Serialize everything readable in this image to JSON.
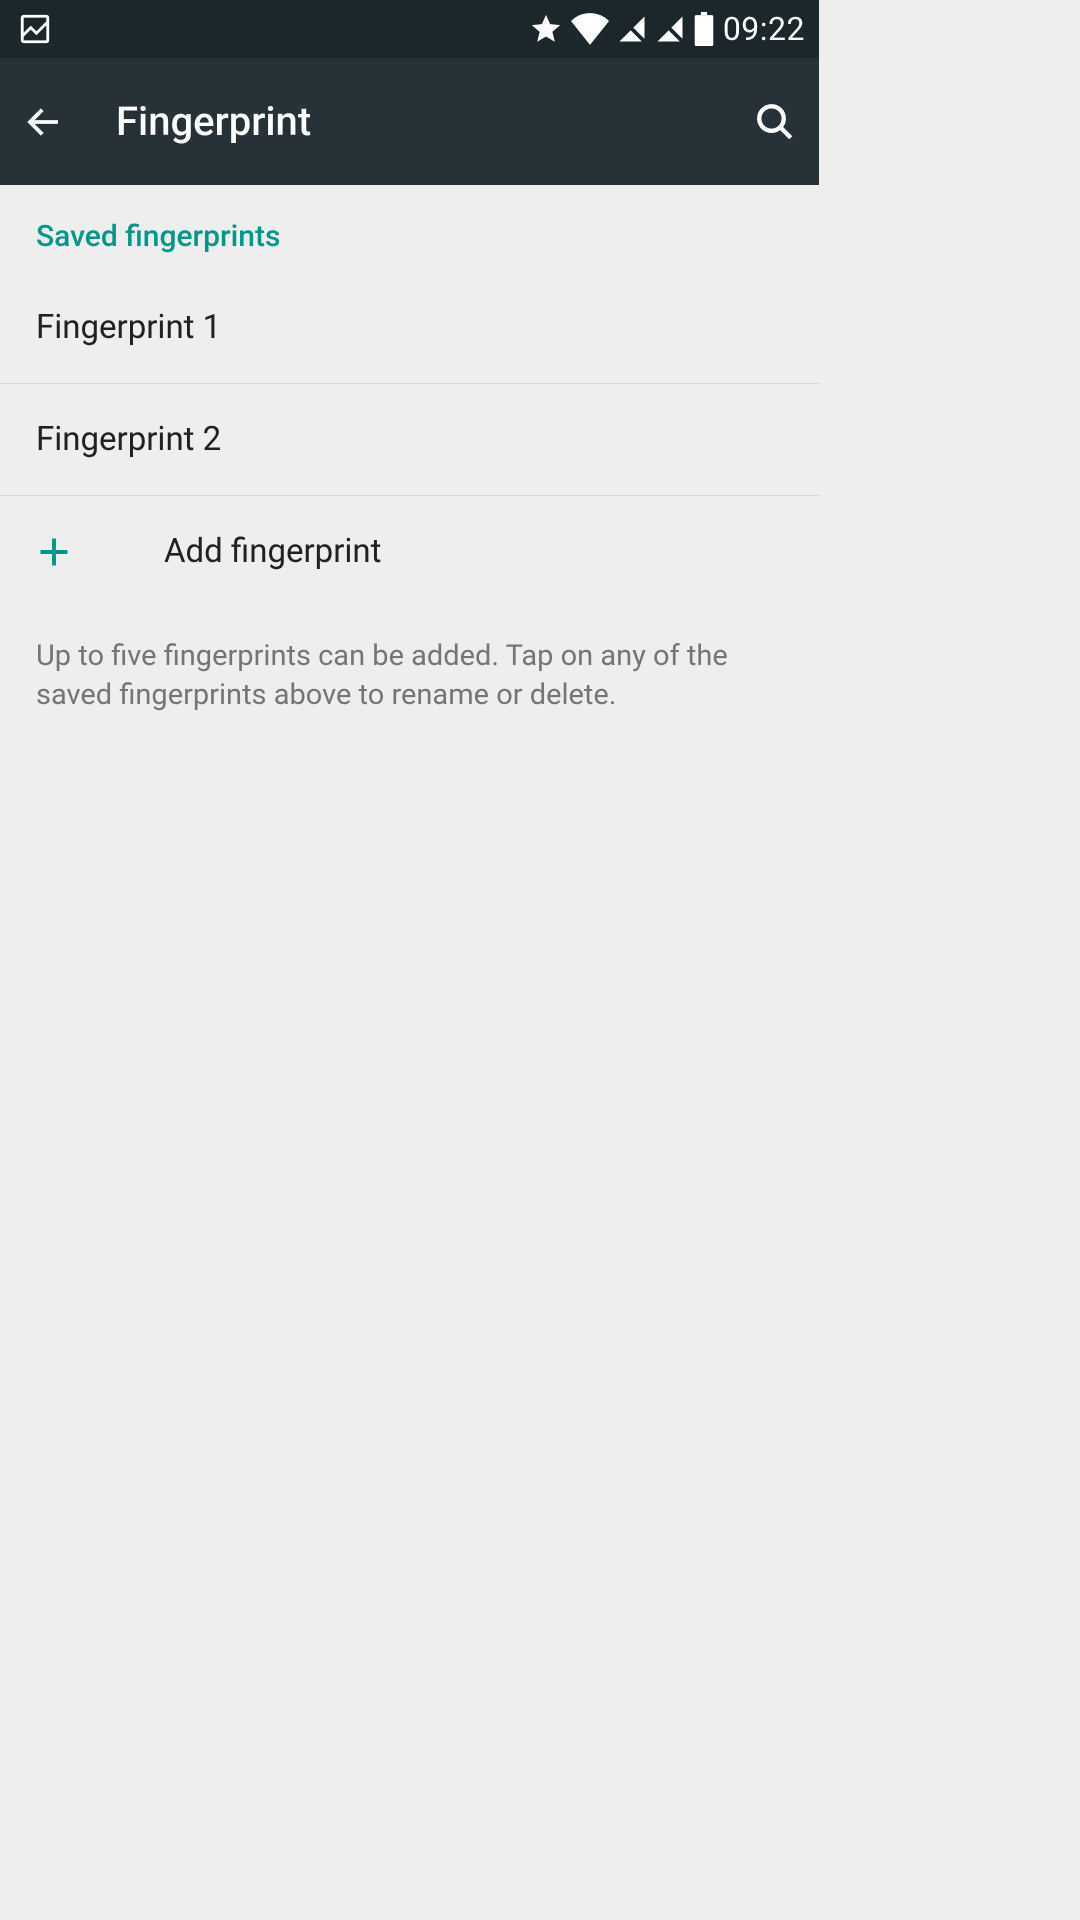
{
  "status": {
    "time": "09:22"
  },
  "appbar": {
    "title": "Fingerprint"
  },
  "section": {
    "header": "Saved fingerprints",
    "items": [
      "Fingerprint 1",
      "Fingerprint 2"
    ],
    "add_label": "Add fingerprint",
    "hint": "Up to five fingerprints can be added. Tap on any of the saved fingerprints above to rename or delete."
  }
}
